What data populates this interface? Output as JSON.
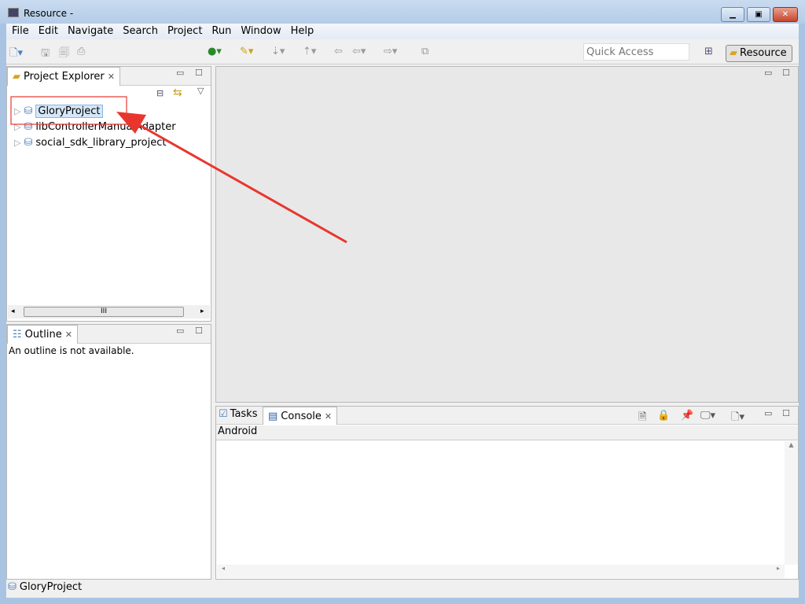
{
  "window": {
    "title": "Resource -"
  },
  "menu": [
    "File",
    "Edit",
    "Navigate",
    "Search",
    "Project",
    "Run",
    "Window",
    "Help"
  ],
  "toolbar": {
    "quick_access_placeholder": "Quick Access",
    "perspective": "Resource"
  },
  "project_explorer": {
    "title": "Project Explorer",
    "items": [
      "GloryProject",
      "libControllerManualAdapter",
      "social_sdk_library_project"
    ],
    "scroll_grip": "III"
  },
  "outline": {
    "title": "Outline",
    "message": "An outline is not available."
  },
  "bottom": {
    "tabs": [
      "Tasks",
      "Console"
    ],
    "console_name": "Android"
  },
  "status": {
    "text": "GloryProject"
  },
  "annotation_color": "#e8362f"
}
